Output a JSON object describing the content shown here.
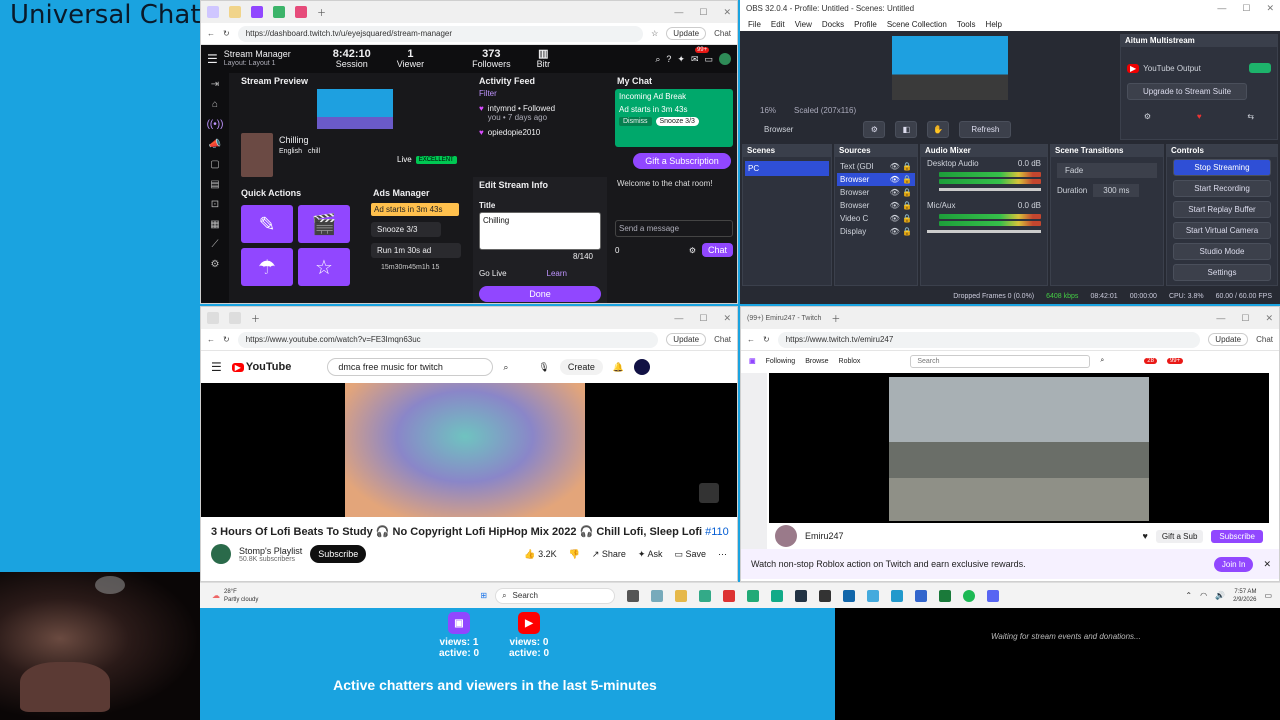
{
  "overlay": {
    "title": "Universal Chat"
  },
  "twitch_dash": {
    "url": "https://dashboard.twitch.tv/u/eyejsquared/stream-manager",
    "update_label": "Update",
    "chat_label_top": "Chat",
    "header": {
      "title": "Stream Manager",
      "layout": "Layout: Layout 1"
    },
    "session": {
      "value": "8:42:10",
      "label": "Session"
    },
    "viewers": {
      "value": "1",
      "label": "Viewer"
    },
    "followers": {
      "value": "373",
      "label": "Followers"
    },
    "bitrate_label": "Bitr",
    "notif_badge": "99+",
    "stream_preview": {
      "title": "Stream Preview",
      "stream_title": "Chilling",
      "tag1": "English",
      "tag2": "chill",
      "live": "Live",
      "quality": "EXCELLENT"
    },
    "activity": {
      "title": "Activity Feed",
      "filter": "Filter",
      "item1_name": "intymnd • Followed",
      "item1_time": "you • 7 days ago",
      "item2_name": "opiedopie2010"
    },
    "my_chat": {
      "title": "My Chat",
      "ad_title": "Incoming Ad Break",
      "ad_starts": "Ad starts in 3m 43s",
      "dismiss": "Dismiss",
      "snooze": "Snooze 3/3",
      "gift": "Gift a Subscription",
      "welcome": "Welcome to the chat room!",
      "placeholder": "Send a message",
      "points": "0",
      "chat_btn": "Chat"
    },
    "edit": {
      "title": "Edit Stream Info",
      "field_label": "Title",
      "field_value": "Chilling",
      "count": "8/140",
      "go_live": "Go Live",
      "learn": "Learn",
      "done": "Done"
    },
    "quick_actions": {
      "title": "Quick Actions"
    },
    "ads": {
      "title": "Ads Manager",
      "ad_starts": "Ad starts in  3m 43s",
      "snooze": "Snooze 3/3",
      "run": "Run 1m 30s ad",
      "next": "15m30m45m1h 15"
    }
  },
  "obs": {
    "title": "OBS 32.0.4 - Profile: Untitled - Scenes: Untitled",
    "menu": [
      "File",
      "Edit",
      "View",
      "Docks",
      "Profile",
      "Scene Collection",
      "Tools",
      "Help"
    ],
    "zoom_label": "16%",
    "scaled_label": "Scaled (207x116)",
    "source_name": "Browser",
    "refresh": "Refresh",
    "aitum": {
      "title": "Aitum Multistream",
      "yt_output": "YouTube Output",
      "upgrade": "Upgrade to Stream Suite"
    },
    "scenes": {
      "title": "Scenes",
      "items": [
        "PC"
      ]
    },
    "sources": {
      "title": "Sources",
      "items": [
        "Text (GDI",
        "Browser",
        "Browser",
        "Browser",
        "Video C",
        "Display"
      ]
    },
    "mixer": {
      "title": "Audio Mixer",
      "ch1": "Desktop Audio",
      "ch1_db": "0.0 dB",
      "ch2": "Mic/Aux",
      "ch2_db": "0.0 dB"
    },
    "transitions": {
      "title": "Scene Transitions",
      "type": "Fade",
      "duration_label": "Duration",
      "duration": "300 ms"
    },
    "controls": {
      "title": "Controls",
      "buttons": [
        "Stop Streaming",
        "Start Recording",
        "Start Replay Buffer",
        "Start Virtual Camera",
        "Studio Mode",
        "Settings"
      ]
    },
    "status": {
      "dropped": "Dropped Frames 0 (0.0%)",
      "kbps": "6408 kbps",
      "time": "08:42:01",
      "rec": "00:00:00",
      "cpu": "CPU: 3.8%",
      "fps": "60.00 / 60.00 FPS"
    }
  },
  "youtube": {
    "url": "https://www.youtube.com/watch?v=FE3Imqn63uc",
    "update_label": "Update",
    "chat_label": "Chat",
    "logo": "YouTube",
    "search": "dmca free music for twitch",
    "create": "Create",
    "video_title": "3 Hours Of Lofi Beats To Study 🎧 No Copyright Lofi HipHop Mix 2022 🎧 Chill Lofi, Sleep Lofi",
    "hashtag": "#110",
    "channel": "Stomp's Playlist",
    "subs": "50.8K subscribers",
    "subscribe": "Subscribe",
    "likes": "3.2K",
    "share": "Share",
    "ask": "Ask",
    "save": "Save"
  },
  "twitch_view": {
    "tab": "(99+) Emiru247 - Twitch",
    "url": "https://www.twitch.tv/emiru247",
    "update_label": "Update",
    "chat_label": "Chat",
    "nav": [
      "Following",
      "Browse",
      "Roblox"
    ],
    "search": "Search",
    "badge1": "28",
    "badge2": "99+",
    "streamer": "Emiru247",
    "gift": "Gift a Sub",
    "subscribe": "Subscribe",
    "banner": "Watch non-stop Roblox action on Twitch and earn exclusive rewards.",
    "join": "Join In"
  },
  "taskbar": {
    "weather_temp": "28°F",
    "weather_desc": "Partly cloudy",
    "search": "Search",
    "time": "7:57 AM",
    "date": "2/9/2026"
  },
  "viewer_widget": {
    "twitch": {
      "views": "views: 1",
      "active": "active: 0"
    },
    "youtube": {
      "views": "views: 0",
      "active": "active: 0"
    },
    "caption": "Active chatters and viewers in the last 5-minutes"
  },
  "events": {
    "text": "Waiting for stream events and donations..."
  }
}
